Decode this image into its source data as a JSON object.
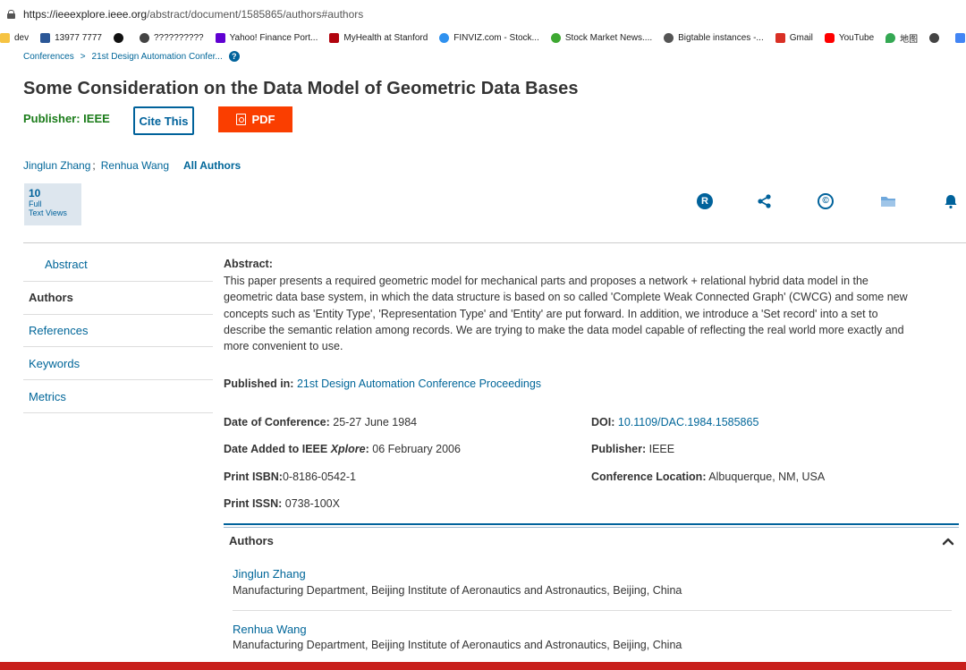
{
  "browser": {
    "url_host": "https://ieeexplore.ieee.org",
    "url_path": "/abstract/document/1585865/authors#authors",
    "bookmarks": [
      {
        "label": "dev",
        "color": "#f6c342"
      },
      {
        "label": "13977 7777",
        "color": "#2b5797"
      },
      {
        "label": "",
        "color": "#111111"
      },
      {
        "label": "??????????",
        "color": "#444444"
      },
      {
        "label": "Yahoo! Finance Port...",
        "color": "#6001d2"
      },
      {
        "label": "MyHealth at Stanford",
        "color": "#b1040e"
      },
      {
        "label": "FINVIZ.com - Stock...",
        "color": "#2f91ef"
      },
      {
        "label": "Stock Market News....",
        "color": "#3ea832"
      },
      {
        "label": "Bigtable instances -...",
        "color": "#555555"
      },
      {
        "label": "Gmail",
        "color": "#d93025"
      },
      {
        "label": "YouTube",
        "color": "#ff0000"
      },
      {
        "label": "地图",
        "color": "#34a853"
      },
      {
        "label": "",
        "color": "#444444"
      },
      {
        "label": "",
        "color": "#4285f4"
      }
    ]
  },
  "breadcrumb": {
    "item1": "Conferences",
    "separator": ">",
    "item2": "21st Design Automation Confer...",
    "help": "?"
  },
  "paper": {
    "title": "Some Consideration on the Data Model of Geometric Data Bases",
    "publisher_line": "Publisher:  IEEE",
    "cite_label": "Cite This",
    "pdf_label": "PDF",
    "authors_inline": [
      "Jinglun Zhang",
      "Renhua Wang"
    ],
    "author_sep": ";",
    "all_authors_label": "All Authors",
    "views_count": "10",
    "views_label_1": "Full",
    "views_label_2": "Text Views"
  },
  "toolbar": {
    "rights_icon_letter": "R",
    "copyright_icon_letter": "©"
  },
  "sidenav": [
    {
      "label": "Abstract",
      "active": false,
      "sub": true
    },
    {
      "label": "Authors",
      "active": true,
      "sub": false
    },
    {
      "label": "References",
      "active": false,
      "sub": false
    },
    {
      "label": "Keywords",
      "active": false,
      "sub": false
    },
    {
      "label": "Metrics",
      "active": false,
      "sub": false
    }
  ],
  "abstract": {
    "heading": "Abstract:",
    "lines": [
      "This paper presents a required geometric model for mechanical parts and proposes a network + relational hybrid data model in the",
      "geometric data base system, in which the data structure is based on so called 'Complete Weak Connected Graph' (CWCG) and some new",
      "concepts such as 'Entity Type', 'Representation Type' and 'Entity' are put forward. In addition, we introduce a 'Set record' into a set to",
      "describe the semantic relation among records. We are trying to make the data model capable of reflecting the real world more exactly and",
      "more convenient to use."
    ]
  },
  "published_in": {
    "label": "Published in:",
    "value": "21st Design Automation Conference Proceedings"
  },
  "meta": {
    "date_conf_label": "Date of Conference:",
    "date_conf_value": "25-27 June 1984",
    "date_added_label": "Date Added to IEEE",
    "date_added_xplore": "Xplore",
    "date_added_value": "06 February 2006",
    "print_isbn_label": "Print ISBN:",
    "print_isbn_value": "0-8186-0542-1",
    "print_issn_label": "Print ISSN:",
    "print_issn_value": "0738-100X",
    "doi_label": "DOI:",
    "doi_value": "10.1109/DAC.1984.1585865",
    "publisher_label": "Publisher:",
    "publisher_value": "IEEE",
    "location_label": "Conference Location:",
    "location_value": "Albuquerque, NM, USA"
  },
  "authors_section": {
    "heading": "Authors",
    "authors": [
      {
        "name": "Jinglun Zhang",
        "affiliation": "Manufacturing Department, Beijing Institute of Aeronautics and Astronautics, Beijing, China"
      },
      {
        "name": "Renhua Wang",
        "affiliation": "Manufacturing Department, Beijing Institute of Aeronautics and Astronautics, Beijing, China"
      }
    ]
  }
}
